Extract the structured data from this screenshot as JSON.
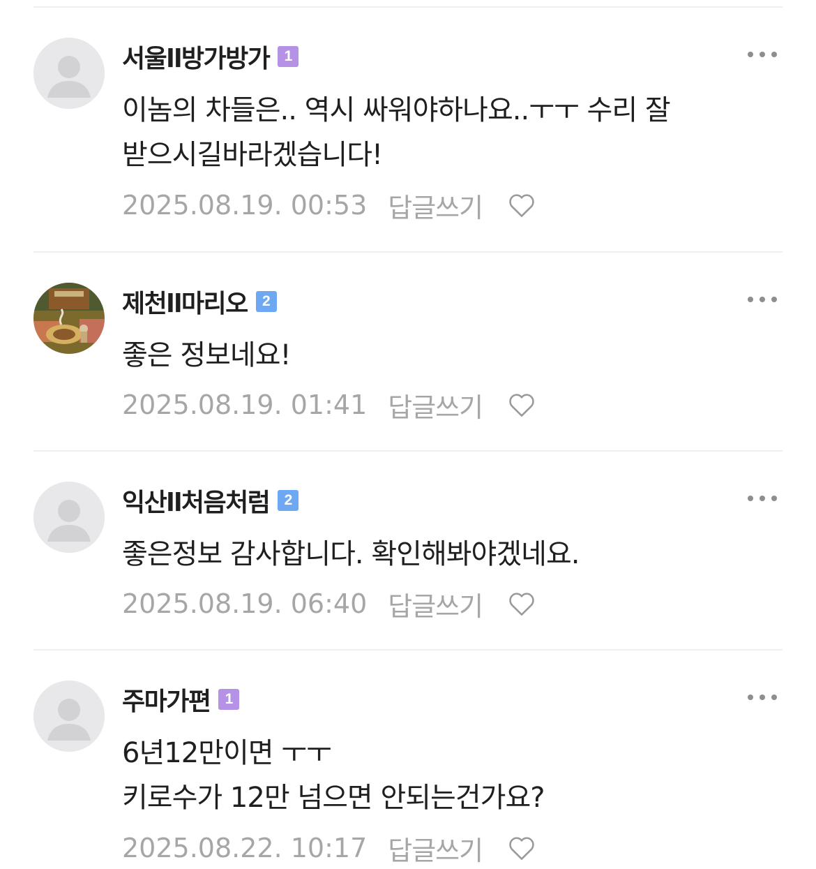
{
  "comments": [
    {
      "author": "서울ll방가방가",
      "grade": "1",
      "grade_color": "#b592e6",
      "avatar": "default-profile-icon",
      "lines": [
        "이놈의 차들은.. 역시 싸워야하나요..ㅜㅜ 수리 잘",
        "받으시길바라겠습니다!"
      ],
      "date": "2025.08.19. 00:53",
      "reply_label": "답글쓰기"
    },
    {
      "author": "제천ll마리오",
      "grade": "2",
      "grade_color": "#6fa8f2",
      "avatar": "profile-photo",
      "lines": [
        "좋은 정보네요!"
      ],
      "date": "2025.08.19. 01:41",
      "reply_label": "답글쓰기"
    },
    {
      "author": "익산ll처음처럼",
      "grade": "2",
      "grade_color": "#6fa8f2",
      "avatar": "default-profile-icon",
      "lines": [
        "좋은정보 감사합니다. 확인해봐야겠네요."
      ],
      "date": "2025.08.19. 06:40",
      "reply_label": "답글쓰기"
    },
    {
      "author": "주마가편",
      "grade": "1",
      "grade_color": "#b592e6",
      "avatar": "default-profile-icon",
      "lines": [
        "6년12만이면 ㅜㅜ",
        "키로수가 12만 넘으면 안되는건가요?"
      ],
      "date": "2025.08.22. 10:17",
      "reply_label": "답글쓰기"
    }
  ],
  "icons": {
    "more": "more-options-icon",
    "like": "heart-outline-icon"
  }
}
